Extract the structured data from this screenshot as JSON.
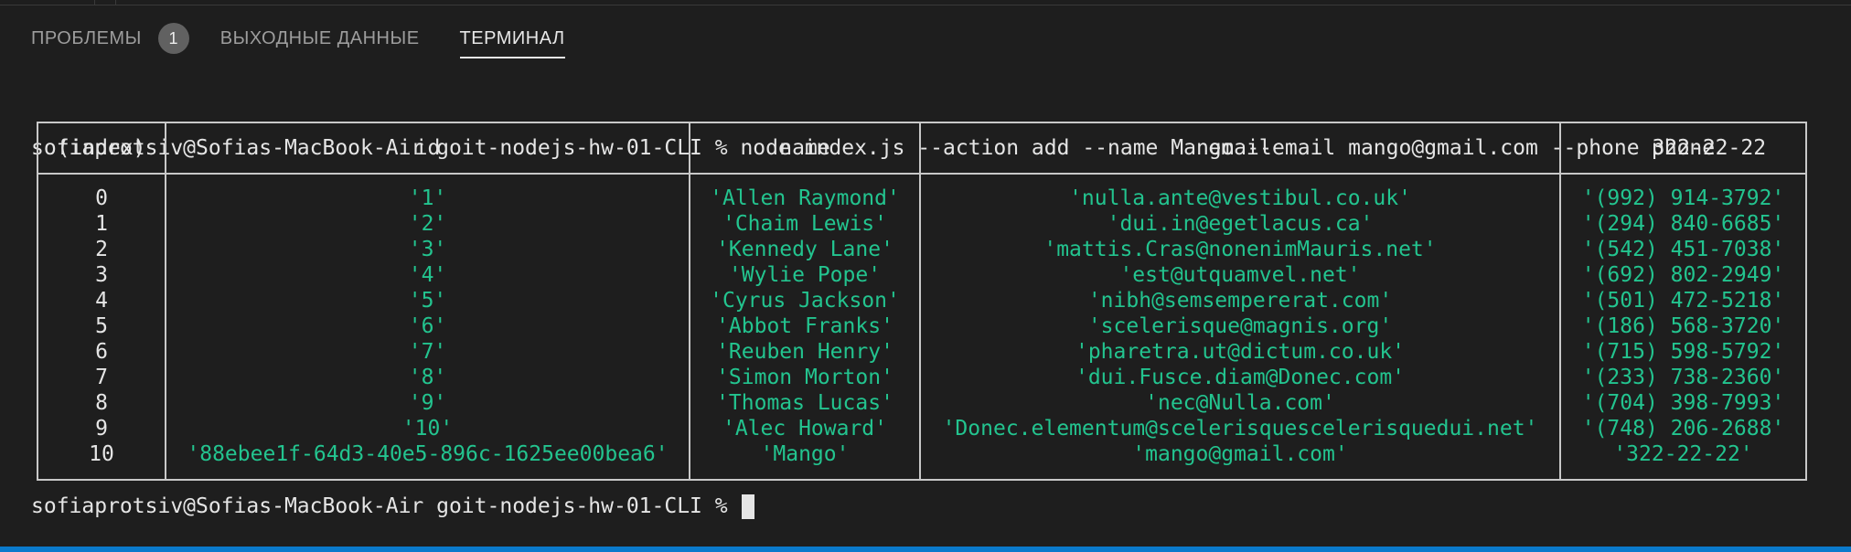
{
  "tabs": [
    {
      "label": "ПРОБЛЕМЫ",
      "badge": "1"
    },
    {
      "label": "ВЫХОДНЫЕ ДАННЫЕ"
    },
    {
      "label": "ТЕРМИНАЛ",
      "active": true
    }
  ],
  "terminal": {
    "command_line": "sofiaprotsiv@Sofias-MacBook-Air goit-nodejs-hw-01-CLI % node index.js --action add --name Mango --email mango@gmail.com --phone 322-22-22",
    "prompt": "sofiaprotsiv@Sofias-MacBook-Air goit-nodejs-hw-01-CLI % ",
    "table": {
      "headers": [
        "(index)",
        "id",
        "name",
        "email",
        "phone"
      ],
      "rows": [
        [
          "0",
          "'1'",
          "'Allen Raymond'",
          "'nulla.ante@vestibul.co.uk'",
          "'(992) 914-3792'"
        ],
        [
          "1",
          "'2'",
          "'Chaim Lewis'",
          "'dui.in@egetlacus.ca'",
          "'(294) 840-6685'"
        ],
        [
          "2",
          "'3'",
          "'Kennedy Lane'",
          "'mattis.Cras@nonenimMauris.net'",
          "'(542) 451-7038'"
        ],
        [
          "3",
          "'4'",
          "'Wylie Pope'",
          "'est@utquamvel.net'",
          "'(692) 802-2949'"
        ],
        [
          "4",
          "'5'",
          "'Cyrus Jackson'",
          "'nibh@semsempererat.com'",
          "'(501) 472-5218'"
        ],
        [
          "5",
          "'6'",
          "'Abbot Franks'",
          "'scelerisque@magnis.org'",
          "'(186) 568-3720'"
        ],
        [
          "6",
          "'7'",
          "'Reuben Henry'",
          "'pharetra.ut@dictum.co.uk'",
          "'(715) 598-5792'"
        ],
        [
          "7",
          "'8'",
          "'Simon Morton'",
          "'dui.Fusce.diam@Donec.com'",
          "'(233) 738-2360'"
        ],
        [
          "8",
          "'9'",
          "'Thomas Lucas'",
          "'nec@Nulla.com'",
          "'(704) 398-7993'"
        ],
        [
          "9",
          "'10'",
          "'Alec Howard'",
          "'Donec.elementum@scelerisquescelerisquedui.net'",
          "'(748) 206-2688'"
        ],
        [
          "10",
          "'88ebee1f-64d3-40e5-896c-1625ee00bea6'",
          "'Mango'",
          "'mango@gmail.com'",
          "'322-22-22'"
        ]
      ]
    }
  },
  "colors": {
    "background": "#1e1e1e",
    "string_green": "#23c48f",
    "text": "#e5e5e5",
    "accent_blue": "#0a7acc"
  }
}
